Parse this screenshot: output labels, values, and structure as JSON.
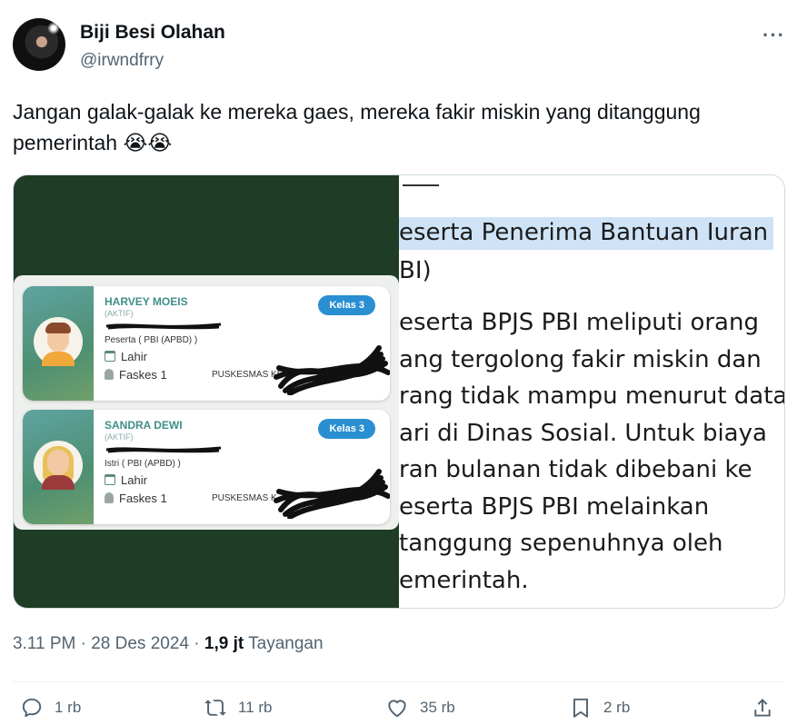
{
  "author": {
    "name": "Biji Besi Olahan",
    "handle": "@irwndfrry",
    "more_label": "···"
  },
  "tweet": {
    "text_line1": "Jangan galak-galak ke mereka gaes, mereka fakir miskin yang ditanggung",
    "text_line2": "pemerintah 😭😭"
  },
  "media": {
    "cards": [
      {
        "name": "HARVEY MOEIS",
        "status": "(AKTIF)",
        "type": "Peserta   ( PBI (APBD) )",
        "lahir": "Lahir",
        "faskes": "Faskes 1",
        "puskesmas": "PUSKESMAS KE",
        "kelas": "Kelas 3"
      },
      {
        "name": "SANDRA DEWI",
        "status": "(AKTIF)",
        "type": "Istri   ( PBI (APBD) )",
        "lahir": "Lahir",
        "faskes": "Faskes 1",
        "puskesmas": "PUSKESMAS K",
        "kelas": "Kelas 3"
      }
    ],
    "article": {
      "heading1": "eserta Penerima Bantuan Iuran",
      "heading2": "BI)",
      "lines": [
        "eserta BPJS PBI meliputi orang",
        "ang tergolong fakir miskin dan",
        "rang tidak mampu menurut data",
        "ari di Dinas Sosial. Untuk biaya",
        "ran bulanan tidak dibebani ke",
        "eserta BPJS PBI melainkan",
        "tanggung sepenuhnya oleh",
        "emerintah."
      ]
    }
  },
  "meta": {
    "time_date": "3.11 PM · 28 Des 2024 · ",
    "views_count": "1,9 jt",
    "views_label": " Tayangan"
  },
  "actions": {
    "reply_count": "1 rb",
    "retweet_count": "11 rb",
    "like_count": "35 rb",
    "bookmark_count": "2 rb"
  },
  "colors": {
    "accent": "#1d9bf0",
    "text": "#0f1419",
    "muted": "#536471",
    "media_bg": "#1f3d26"
  }
}
